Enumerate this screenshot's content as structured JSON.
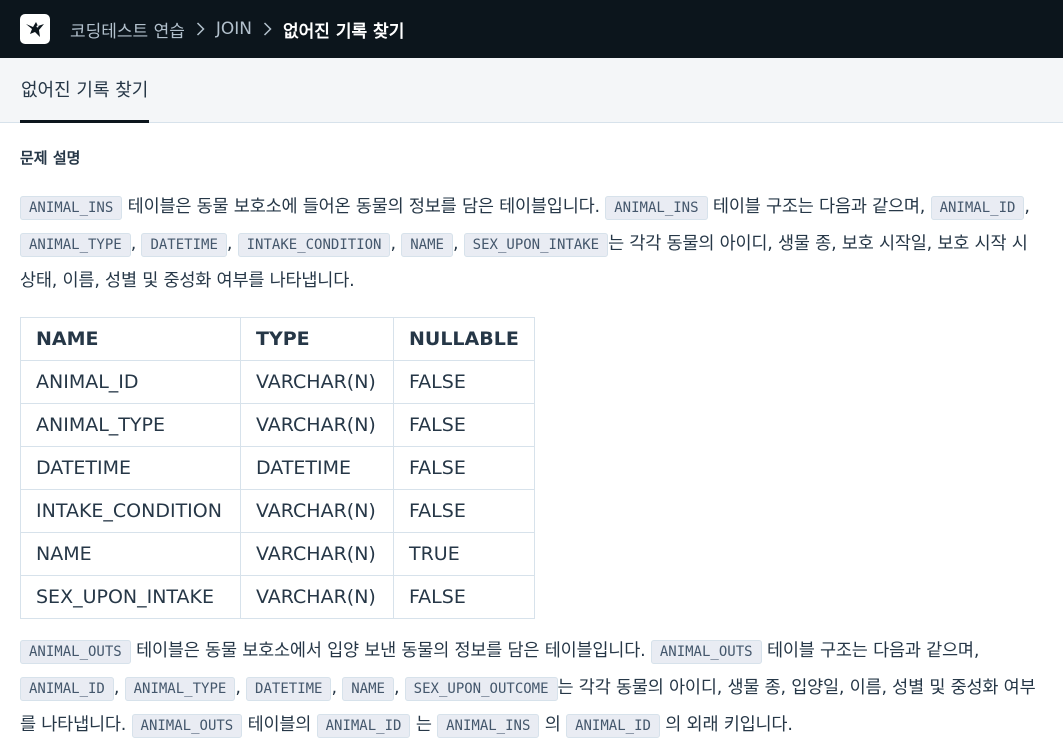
{
  "breadcrumb": {
    "items": [
      "코딩테스트 연습",
      "JOIN"
    ],
    "current": "없어진 기록 찾기"
  },
  "tab": {
    "label": "없어진 기록 찾기"
  },
  "section_title": "문제 설명",
  "para1": {
    "code_ins_1": "ANIMAL_INS",
    "text_1": "테이블은 동물 보호소에 들어온 동물의 정보를 담은 테이블입니다.",
    "code_ins_2": "ANIMAL_INS",
    "text_2": "테이블 구조는 다음과 같으며,",
    "col_codes": [
      "ANIMAL_ID",
      "ANIMAL_TYPE",
      "DATETIME",
      "INTAKE_CONDITION",
      "NAME",
      "SEX_UPON_INTAKE"
    ],
    "text_3": "는 각각 동물의 아이디, 생물 종, 보호 시작일, 보호 시작 시 상태, 이름, 성별 및 중성화 여부를 나타냅니다."
  },
  "table": {
    "headers": [
      "NAME",
      "TYPE",
      "NULLABLE"
    ],
    "rows": [
      [
        "ANIMAL_ID",
        "VARCHAR(N)",
        "FALSE"
      ],
      [
        "ANIMAL_TYPE",
        "VARCHAR(N)",
        "FALSE"
      ],
      [
        "DATETIME",
        "DATETIME",
        "FALSE"
      ],
      [
        "INTAKE_CONDITION",
        "VARCHAR(N)",
        "FALSE"
      ],
      [
        "NAME",
        "VARCHAR(N)",
        "TRUE"
      ],
      [
        "SEX_UPON_INTAKE",
        "VARCHAR(N)",
        "FALSE"
      ]
    ]
  },
  "para2": {
    "code_outs_1": "ANIMAL_OUTS",
    "text_1": "테이블은 동물 보호소에서 입양 보낸 동물의 정보를 담은 테이블입니다.",
    "code_outs_2": "ANIMAL_OUTS",
    "text_2": "테이블 구조는 다음과 같으며,",
    "col_codes": [
      "ANIMAL_ID",
      "ANIMAL_TYPE",
      "DATETIME",
      "NAME",
      "SEX_UPON_OUTCOME"
    ],
    "text_3": "는 각각 동물의 아이디, 생물 종, 입양일, 이름, 성별 및 중성화 여부를 나타냅니다.",
    "code_outs_3": "ANIMAL_OUTS",
    "text_4": "테이블의",
    "code_id_1": "ANIMAL_ID",
    "text_5": "는",
    "code_ins": "ANIMAL_INS",
    "text_6": "의",
    "code_id_2": "ANIMAL_ID",
    "text_7": "의 외래 키입니다."
  },
  "icons": {
    "logo": "bird-logo-icon",
    "separator": "chevron-right-icon"
  },
  "colors": {
    "topbar": "#0c151c",
    "tab_underline": "#0c151c",
    "code_bg": "#e9ecf3"
  }
}
